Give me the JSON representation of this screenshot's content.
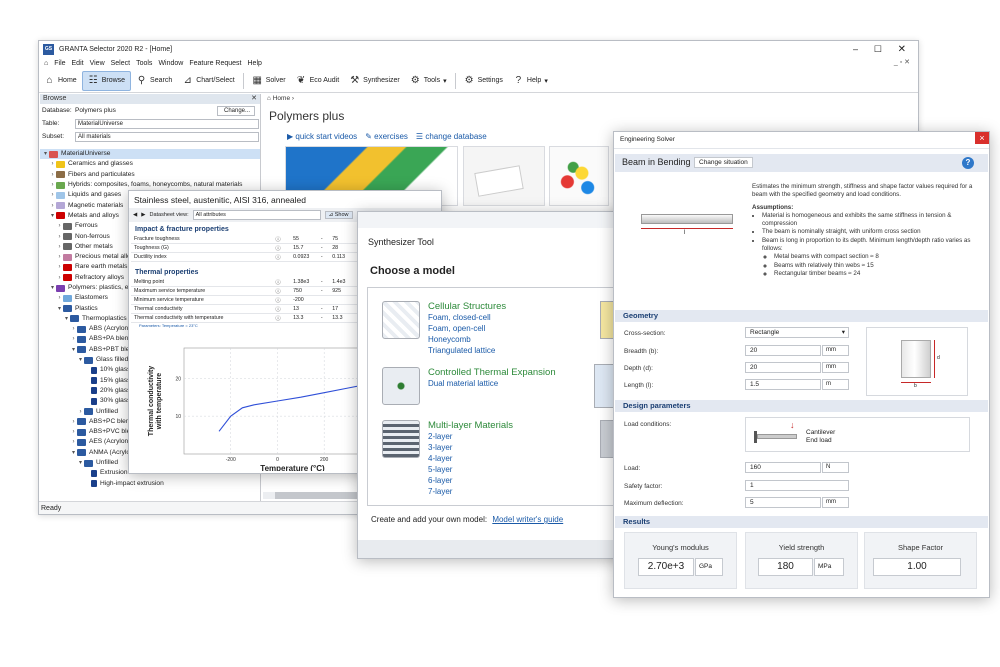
{
  "main": {
    "title": "GRANTA Selector 2020 R2 - [Home]",
    "app_icon": "GS",
    "menu": [
      "File",
      "Edit",
      "View",
      "Select",
      "Tools",
      "Window",
      "Feature Request",
      "Help"
    ],
    "toolbar": {
      "home": "Home",
      "browse": "Browse",
      "search": "Search",
      "chart": "Chart/Select",
      "solver": "Solver",
      "eco": "Eco Audit",
      "synth": "Synthesizer",
      "tools": "Tools",
      "settings": "Settings",
      "help": "Help"
    },
    "browse": {
      "header": "Browse",
      "database_label": "Database:",
      "database_value": "Polymers plus",
      "change": "Change...",
      "table_label": "Table:",
      "table_value": "MaterialUniverse",
      "subset_label": "Subset:",
      "subset_value": "All materials"
    },
    "tree": [
      {
        "label": "MaterialUniverse",
        "indent": 0,
        "arrow": "▾",
        "color": "#d9534f",
        "sel": true
      },
      {
        "label": "Ceramics and glasses",
        "indent": 1,
        "arrow": "›",
        "color": "#f0c419"
      },
      {
        "label": "Fibers and particulates",
        "indent": 1,
        "arrow": "›",
        "color": "#8c6d46"
      },
      {
        "label": "Hybrids: composites, foams, honeycombs, natural materials",
        "indent": 1,
        "arrow": "›",
        "color": "#6aa84f"
      },
      {
        "label": "Liquids and gases",
        "indent": 1,
        "arrow": "›",
        "color": "#9fc5e8"
      },
      {
        "label": "Magnetic materials",
        "indent": 1,
        "arrow": "›",
        "color": "#b4a7d6"
      },
      {
        "label": "Metals and alloys",
        "indent": 1,
        "arrow": "▾",
        "color": "#cc0000"
      },
      {
        "label": "Ferrous",
        "indent": 2,
        "arrow": "›",
        "color": "#666666"
      },
      {
        "label": "Non-ferrous",
        "indent": 2,
        "arrow": "›",
        "color": "#666666"
      },
      {
        "label": "Other metals",
        "indent": 2,
        "arrow": "›",
        "color": "#666666"
      },
      {
        "label": "Precious metal alloys",
        "indent": 2,
        "arrow": "›",
        "color": "#c27ba0"
      },
      {
        "label": "Rare earth metals",
        "indent": 2,
        "arrow": "›",
        "color": "#cc0000"
      },
      {
        "label": "Refractory alloys",
        "indent": 2,
        "arrow": "›",
        "color": "#cc0000"
      },
      {
        "label": "Polymers: plastics, elastomers",
        "indent": 1,
        "arrow": "▾",
        "color": "#7a3fb0"
      },
      {
        "label": "Elastomers",
        "indent": 2,
        "arrow": "›",
        "color": "#6fa8dc"
      },
      {
        "label": "Plastics",
        "indent": 2,
        "arrow": "▾",
        "color": "#2c5aa0"
      },
      {
        "label": "Thermoplastics",
        "indent": 3,
        "arrow": "▾",
        "color": "#2c5aa0"
      },
      {
        "label": "ABS (Acrylonitrile",
        "indent": 4,
        "arrow": "›",
        "color": "#2c5aa0"
      },
      {
        "label": "ABS+PA blend",
        "indent": 4,
        "arrow": "›",
        "color": "#2c5aa0"
      },
      {
        "label": "ABS+PBT blend",
        "indent": 4,
        "arrow": "▾",
        "color": "#2c5aa0"
      },
      {
        "label": "Glass filled",
        "indent": 5,
        "arrow": "▾",
        "color": "#2c5aa0"
      },
      {
        "label": "10% glass",
        "indent": 6,
        "arrow": "",
        "color": "#1a3f8a"
      },
      {
        "label": "15% glass",
        "indent": 6,
        "arrow": "",
        "color": "#1a3f8a"
      },
      {
        "label": "20% glass",
        "indent": 6,
        "arrow": "",
        "color": "#1a3f8a"
      },
      {
        "label": "30% glass",
        "indent": 6,
        "arrow": "",
        "color": "#1a3f8a"
      },
      {
        "label": "Unfilled",
        "indent": 5,
        "arrow": "›",
        "color": "#2c5aa0"
      },
      {
        "label": "ABS+PC blend",
        "indent": 4,
        "arrow": "›",
        "color": "#2c5aa0"
      },
      {
        "label": "ABS+PVC blend",
        "indent": 4,
        "arrow": "›",
        "color": "#2c5aa0"
      },
      {
        "label": "AES (Acrylonitrile",
        "indent": 4,
        "arrow": "›",
        "color": "#2c5aa0"
      },
      {
        "label": "ANMA (Acrylo",
        "indent": 4,
        "arrow": "▾",
        "color": "#2c5aa0"
      },
      {
        "label": "Unfilled",
        "indent": 5,
        "arrow": "▾",
        "color": "#2c5aa0"
      },
      {
        "label": "Extrusion",
        "indent": 6,
        "arrow": "",
        "color": "#1a3f8a"
      },
      {
        "label": "High-impact extrusion",
        "indent": 6,
        "arrow": "",
        "color": "#1a3f8a"
      }
    ],
    "home_crumb": "Home",
    "page_title": "Polymers plus",
    "links": {
      "videos": "quick start videos",
      "exercises": "exercises",
      "change_db": "change database"
    },
    "status": "Ready"
  },
  "datasheet": {
    "title": "Stainless steel, austenitic, AISI 316, annealed",
    "view_label": "Datasheet view:",
    "view_value": "All attributes",
    "show": "Show",
    "sec1": "Impact & fracture properties",
    "rows1": [
      [
        "Fracture toughness",
        "55",
        "-",
        "75"
      ],
      [
        "Toughness (G)",
        "15.7",
        "-",
        "28"
      ],
      [
        "Ductility index",
        "0.0923",
        "-",
        "0.113"
      ]
    ],
    "sec2": "Thermal properties",
    "rows2": [
      [
        "Melting point",
        "1.38e3",
        "-",
        "1.4e3"
      ],
      [
        "Maximum service temperature",
        "750",
        "-",
        "925"
      ],
      [
        "Minimum service temperature",
        "-200",
        "",
        ""
      ],
      [
        "Thermal conductivity",
        "13",
        "-",
        "17"
      ],
      [
        "Thermal conductivity with temperature",
        "13.3",
        "-",
        "13.3"
      ]
    ],
    "param": "Parameters: Temperature = 23°C"
  },
  "chart_data": {
    "type": "line",
    "ylabel": "Thermal conductivity with temperature",
    "xlabel": "Temperature (°C)",
    "x_ticks": [
      "-200",
      "0",
      "200",
      "400",
      "600"
    ],
    "y_ticks": [
      "10",
      "20"
    ],
    "xlim": [
      -400,
      700
    ],
    "ylim": [
      0,
      28
    ],
    "series": [
      {
        "x": [
          -250,
          -200,
          -150,
          -100,
          0,
          100,
          200,
          300,
          400,
          500,
          600,
          700
        ],
        "y": [
          6,
          10,
          12.2,
          13,
          14,
          15,
          16.2,
          17.4,
          18.6,
          19.8,
          21,
          22.2
        ]
      }
    ]
  },
  "synth": {
    "title": "Synthesizer Tool",
    "choose": "Choose a model",
    "models": [
      {
        "title": "Cellular Structures",
        "items": [
          "Foam, closed-cell",
          "Foam, open-cell",
          "Honeycomb",
          "Triangulated lattice"
        ]
      },
      {
        "title": "Controlled Thermal Expansion",
        "items": [
          "Dual material lattice"
        ]
      },
      {
        "title": "Multi-layer Materials",
        "items": [
          "2-layer",
          "3-layer",
          "4-layer",
          "5-layer",
          "6-layer",
          "7-layer"
        ]
      }
    ],
    "footer_text": "Create and add your own model:",
    "footer_link": "Model writer's guide"
  },
  "engineering": {
    "title": "Engineering Solver",
    "close": "×",
    "heading": "Beam in Bending",
    "change": "Change situation",
    "help": "?",
    "beam_dim": "l",
    "desc": "Estimates the minimum strength, stiffness and shape factor values required for a beam with the specified geometry and load conditions.",
    "assumptions_title": "Assumptions:",
    "assumptions": [
      "Material is homogeneous and exhibits the same stiffness in tension & compression",
      "The beam is nominally straight, with uniform cross section",
      "Beam is long in proportion to its depth. Minimum length/depth ratio varies as follows:"
    ],
    "ratios": [
      "Metal beams with compact section ≈ 8",
      "Beams with relatively thin webs ≈ 15",
      "Rectangular timber beams ≈ 24"
    ],
    "geometry": "Geometry",
    "cross_label": "Cross-section:",
    "cross_value": "Rectangle",
    "breadth_label": "Breadth (b):",
    "breadth": "20",
    "breadth_unit": "mm",
    "depth_label": "Depth (d):",
    "depth": "20",
    "depth_unit": "mm",
    "length_label": "Length (l):",
    "length": "1.5",
    "length_unit": "m",
    "xsec_b": "b",
    "xsec_d": "d",
    "design": "Design parameters",
    "load_cond_label": "Load conditions:",
    "load_cond": [
      "Cantilever",
      "End load"
    ],
    "load_label": "Load:",
    "load": "160",
    "load_unit": "N",
    "safety_label": "Safety factor:",
    "safety": "1",
    "deflect_label": "Maximum deflection:",
    "deflect": "5",
    "deflect_unit": "mm",
    "results": "Results",
    "young_label": "Young's modulus",
    "young": "2.70e+3",
    "young_unit": "GPa",
    "yield_label": "Yield strength",
    "yield": "180",
    "yield_unit": "MPa",
    "shape_label": "Shape Factor",
    "shape": "1.00"
  }
}
